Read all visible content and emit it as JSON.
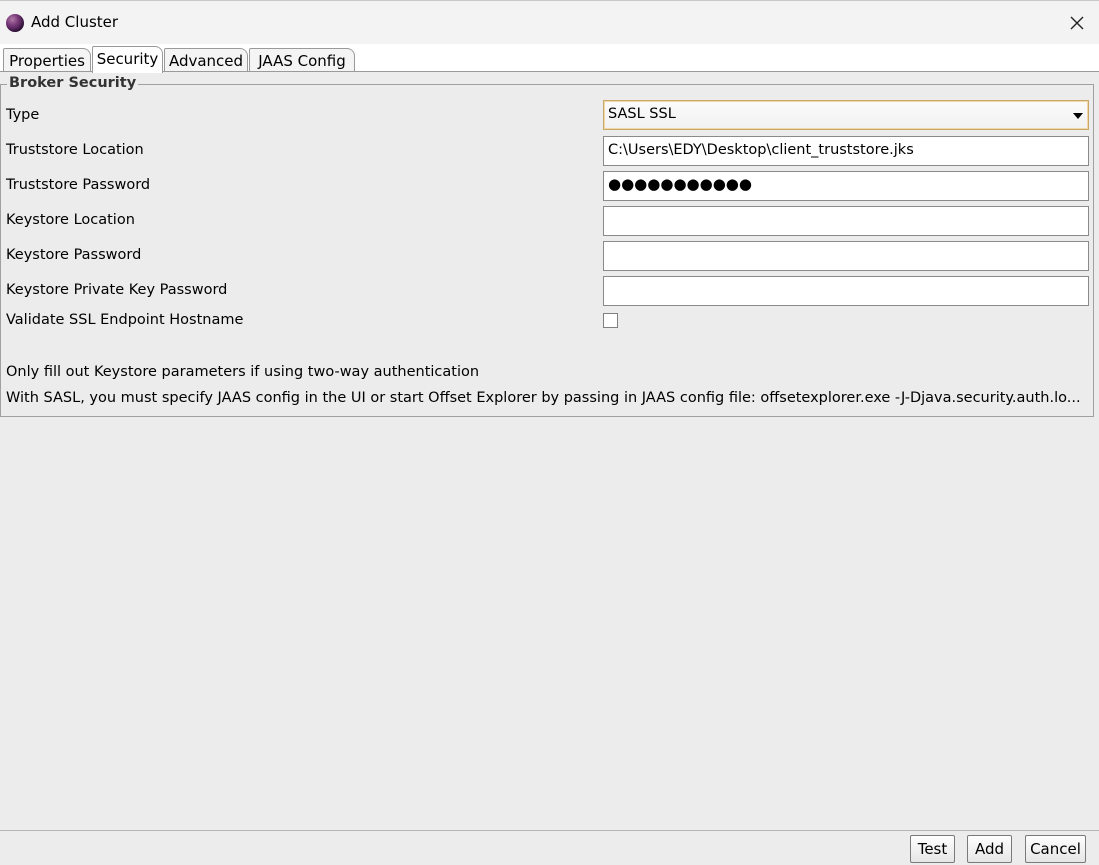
{
  "window": {
    "title": "Add Cluster"
  },
  "tabs": [
    {
      "label": "Properties"
    },
    {
      "label": "Security"
    },
    {
      "label": "Advanced"
    },
    {
      "label": "JAAS Config"
    }
  ],
  "active_tab": "Security",
  "broker_security": {
    "group_title": "Broker Security",
    "type": {
      "label": "Type",
      "value": "SASL SSL"
    },
    "truststore_location": {
      "label": "Truststore Location",
      "value": "C:\\Users\\EDY\\Desktop\\client_truststore.jks"
    },
    "truststore_password": {
      "label": "Truststore Password",
      "value": "●●●●●●●●●●●"
    },
    "keystore_location": {
      "label": "Keystore Location",
      "value": ""
    },
    "keystore_password": {
      "label": "Keystore Password",
      "value": ""
    },
    "keystore_private_key_password": {
      "label": "Keystore Private Key Password",
      "value": ""
    },
    "validate_ssl": {
      "label": "Validate SSL Endpoint Hostname",
      "checked": false
    },
    "note_keystore": "Only fill out Keystore parameters if using two-way authentication",
    "note_sasl": "With SASL, you must specify JAAS config in the UI or start Offset Explorer by passing in JAAS config file: offsetexplorer.exe -J-Djava.security.auth.lo..."
  },
  "buttons": {
    "test": "Test",
    "add": "Add",
    "cancel": "Cancel"
  },
  "icons": {
    "app": "app-icon",
    "close": "close-icon",
    "dropdown": "chevron-down-icon"
  }
}
